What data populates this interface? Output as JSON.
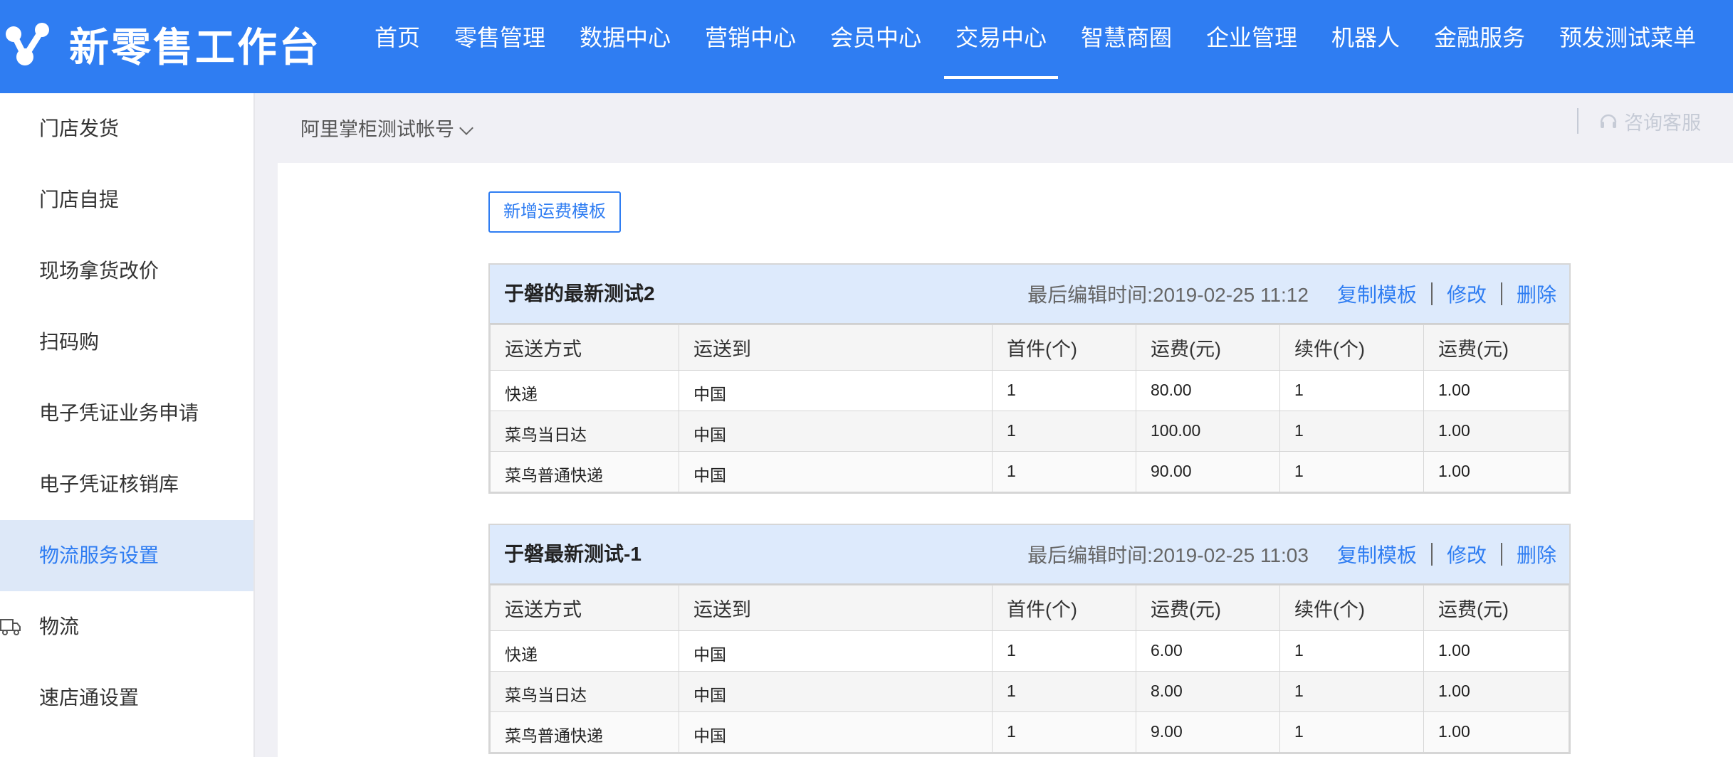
{
  "app": {
    "logo_text": "新零售工作台"
  },
  "nav": {
    "items": [
      {
        "label": "首页"
      },
      {
        "label": "零售管理"
      },
      {
        "label": "数据中心"
      },
      {
        "label": "营销中心"
      },
      {
        "label": "会员中心"
      },
      {
        "label": "交易中心",
        "active": true
      },
      {
        "label": "智慧商圈"
      },
      {
        "label": "企业管理"
      },
      {
        "label": "机器人"
      },
      {
        "label": "金融服务"
      },
      {
        "label": "预发测试菜单"
      }
    ]
  },
  "sidebar": {
    "items": [
      {
        "label": "门店发货"
      },
      {
        "label": "门店自提"
      },
      {
        "label": "现场拿货改价"
      },
      {
        "label": "扫码购"
      },
      {
        "label": "电子凭证业务申请"
      },
      {
        "label": "电子凭证核销库"
      },
      {
        "label": "物流服务设置",
        "active": true
      },
      {
        "label": "物流",
        "icon": "truck-icon"
      },
      {
        "label": "速店通设置"
      }
    ]
  },
  "header": {
    "account": "阿里掌柜测试帐号",
    "service": "咨询客服"
  },
  "main": {
    "add_button": "新增运费模板",
    "columns": [
      "运送方式",
      "运送到",
      "首件(个)",
      "运费(元)",
      "续件(个)",
      "运费(元)"
    ],
    "templates": [
      {
        "name": "于磐的最新测试2",
        "time": "最后编辑时间:2019-02-25 11:12",
        "actions": [
          "复制模板",
          "修改",
          "删除"
        ],
        "rows": [
          [
            "快递",
            "中国",
            "1",
            "80.00",
            "1",
            "1.00"
          ],
          [
            "菜鸟当日达",
            "中国",
            "1",
            "100.00",
            "1",
            "1.00"
          ],
          [
            "菜鸟普通快递",
            "中国",
            "1",
            "90.00",
            "1",
            "1.00"
          ]
        ]
      },
      {
        "name": "于磐最新测试-1",
        "time": "最后编辑时间:2019-02-25 11:03",
        "actions": [
          "复制模板",
          "修改",
          "删除"
        ],
        "rows": [
          [
            "快递",
            "中国",
            "1",
            "6.00",
            "1",
            "1.00"
          ],
          [
            "菜鸟当日达",
            "中国",
            "1",
            "8.00",
            "1",
            "1.00"
          ],
          [
            "菜鸟普通快递",
            "中国",
            "1",
            "9.00",
            "1",
            "1.00"
          ]
        ]
      }
    ]
  },
  "colors": {
    "brand": "#2f7df2",
    "sidebar_active_bg": "#dde8f8",
    "table_head_bg": "#ddeafc"
  }
}
